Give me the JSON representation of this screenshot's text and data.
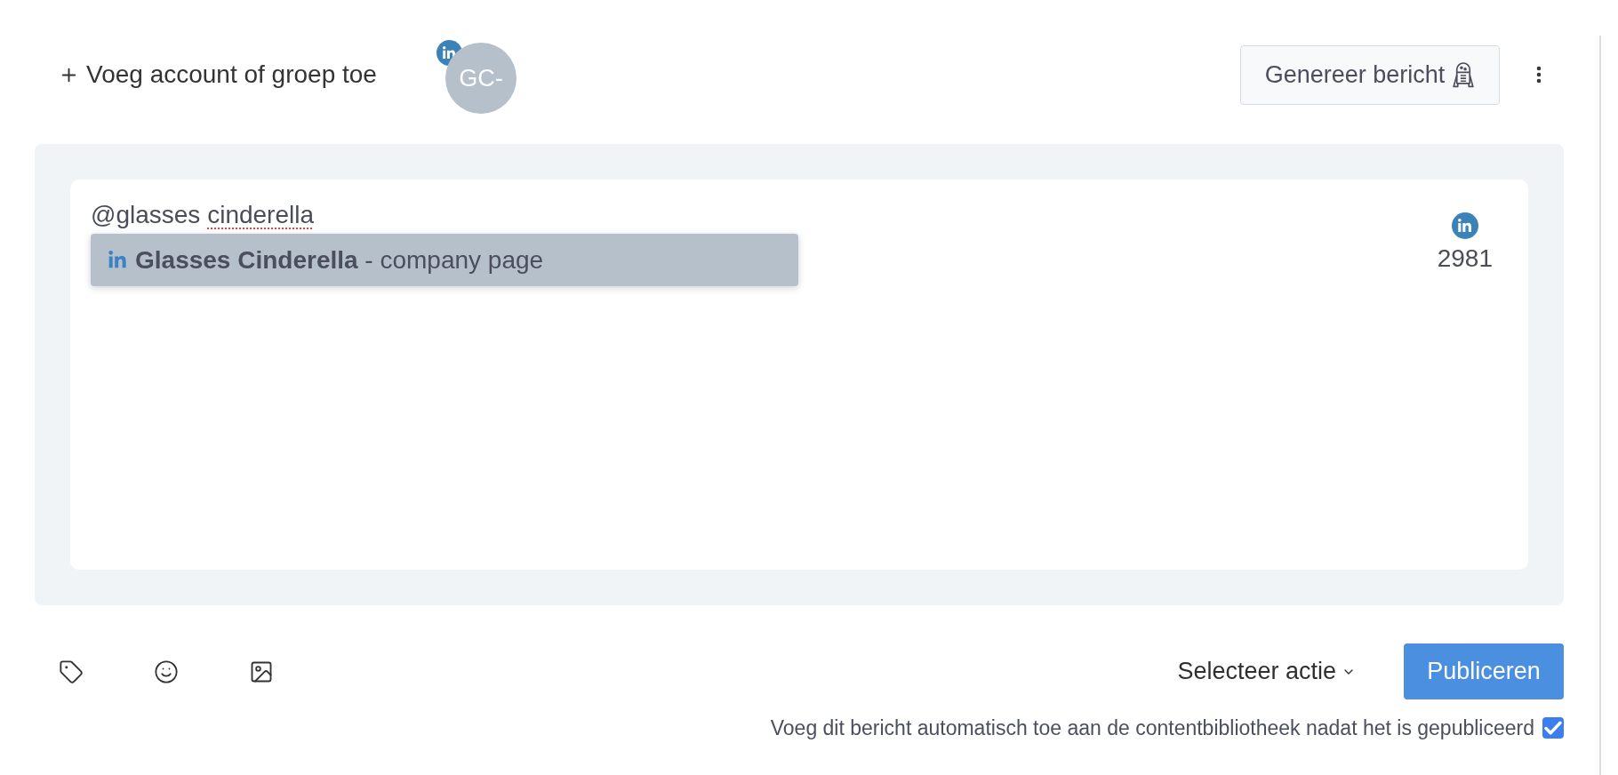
{
  "header": {
    "add_account": "Voeg account of groep toe",
    "accounts": [
      {
        "initials": "GC-"
      }
    ],
    "generate_button": "Genereer bericht"
  },
  "editor": {
    "segments": [
      {
        "text": "@glasses",
        "misspelled": false
      },
      {
        "text": "cinderella",
        "misspelled": true
      }
    ],
    "suggestions": [
      {
        "label": "**Glasses Cinderella** - company page",
        "selected": true
      }
    ],
    "counters": [
      {
        "count": "2981"
      }
    ]
  },
  "footer": {
    "action_select": "Selecteer actie",
    "publish_button": "Publiceren",
    "auto_add": {
      "label": "Voeg dit bericht automatisch toe aan de contentbibliotheek nadat het is gepubliceerd",
      "checked": true
    }
  }
}
